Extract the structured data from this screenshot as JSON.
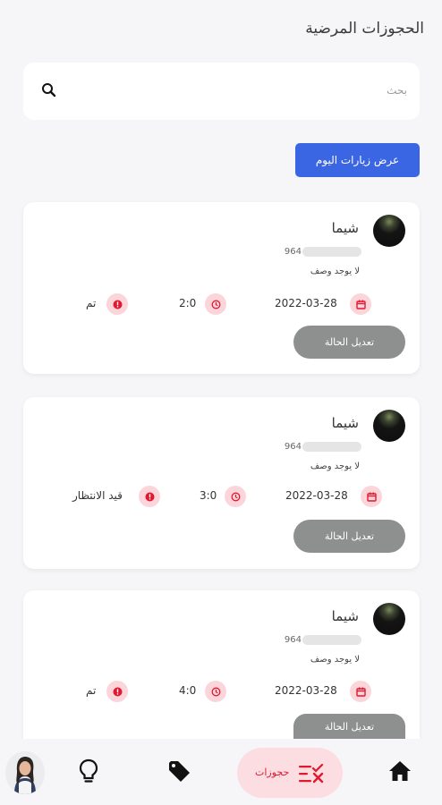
{
  "header": {
    "title": "الحجوزات المرضية"
  },
  "search": {
    "placeholder": "بحث"
  },
  "today_button": {
    "label": "عرض زيارات اليوم"
  },
  "bookings": [
    {
      "name": "شيما",
      "phone_prefix": "964",
      "description": "لا يوجد وصف",
      "date": "2022-03-28",
      "time": "2:0",
      "status": "تم",
      "edit_label": "تعديل الحالة"
    },
    {
      "name": "شيما",
      "phone_prefix": "964",
      "description": "لا يوجد وصف",
      "date": "2022-03-28",
      "time": "3:0",
      "status": "قيد الانتظار",
      "edit_label": "تعديل الحالة"
    },
    {
      "name": "شيما",
      "phone_prefix": "964",
      "description": "لا يوجد وصف",
      "date": "2022-03-28",
      "time": "4:0",
      "status": "تم",
      "edit_label": "تعديل الحالة"
    }
  ],
  "nav": {
    "items": [
      {
        "icon": "home-icon"
      },
      {
        "icon": "bookings-icon",
        "label": "حجوزات",
        "active": true
      },
      {
        "icon": "tag-icon"
      },
      {
        "icon": "lightbulb-icon"
      },
      {
        "icon": "profile-avatar"
      }
    ]
  },
  "colors": {
    "primary": "#3a66e3",
    "accent": "#e2182f",
    "accent_soft": "#fbd5da",
    "edit_button": "#8e9090"
  }
}
